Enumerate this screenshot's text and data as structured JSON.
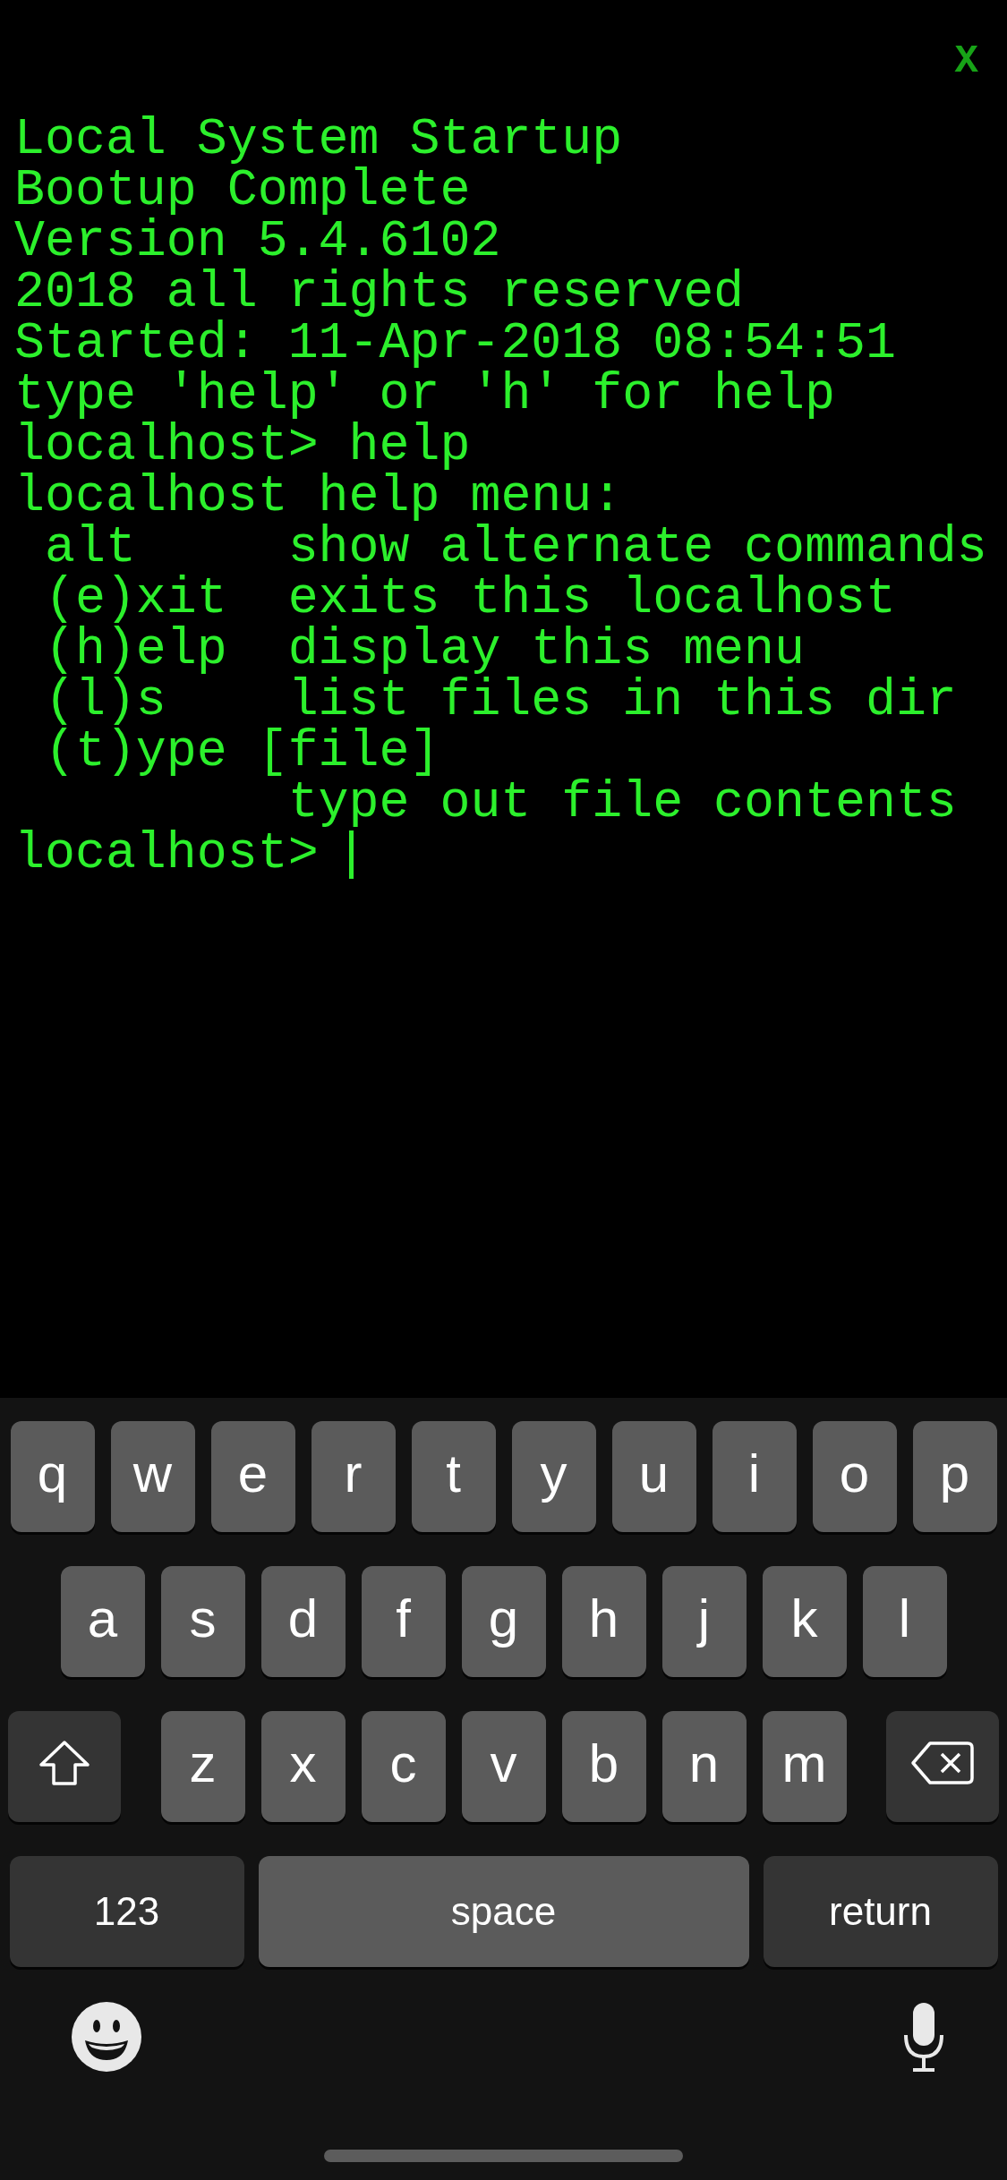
{
  "terminal": {
    "close_button": "X",
    "lines": [
      {
        "kind": "output",
        "text": "Local System Startup"
      },
      {
        "kind": "output",
        "text": "Bootup Complete"
      },
      {
        "kind": "output",
        "text": "Version 5.4.6102"
      },
      {
        "kind": "output",
        "text": "2018 all rights reserved"
      },
      {
        "kind": "output",
        "text": "Started: 11-Apr-2018 08:54:51"
      },
      {
        "kind": "output",
        "text": "type 'help' or 'h' for help"
      },
      {
        "kind": "prompt",
        "text": "localhost> help",
        "cursor": false
      },
      {
        "kind": "output",
        "text": "localhost help menu:"
      },
      {
        "kind": "menu_item",
        "command": "alt",
        "description": "show alternate commands"
      },
      {
        "kind": "menu_item",
        "command": "(e)xit",
        "description": "exits this localhost"
      },
      {
        "kind": "menu_item",
        "command": "(h)elp",
        "description": "display this menu"
      },
      {
        "kind": "menu_item",
        "command": "(l)s",
        "description": "list files in this dir"
      },
      {
        "kind": "menu_item",
        "command": "(t)ype [file]"
      },
      {
        "kind": "menu_item",
        "description": "type out file contents"
      },
      {
        "kind": "prompt",
        "text": "localhost>",
        "cursor": true
      }
    ]
  },
  "keyboard": {
    "letter_rows": [
      [
        {
          "kind": "letter",
          "label": "q"
        },
        {
          "kind": "letter",
          "label": "w"
        },
        {
          "kind": "letter",
          "label": "e"
        },
        {
          "kind": "letter",
          "label": "r"
        },
        {
          "kind": "letter",
          "label": "t"
        },
        {
          "kind": "letter",
          "label": "y"
        },
        {
          "kind": "letter",
          "label": "u"
        },
        {
          "kind": "letter",
          "label": "i"
        },
        {
          "kind": "letter",
          "label": "o"
        },
        {
          "kind": "letter",
          "label": "p"
        }
      ],
      [
        {
          "kind": "letter",
          "label": "a"
        },
        {
          "kind": "letter",
          "label": "s"
        },
        {
          "kind": "letter",
          "label": "d"
        },
        {
          "kind": "letter",
          "label": "f"
        },
        {
          "kind": "letter",
          "label": "g"
        },
        {
          "kind": "letter",
          "label": "h"
        },
        {
          "kind": "letter",
          "label": "j"
        },
        {
          "kind": "letter",
          "label": "k"
        },
        {
          "kind": "letter",
          "label": "l"
        }
      ],
      [
        {
          "kind": "shift"
        },
        {
          "kind": "letter",
          "label": "z"
        },
        {
          "kind": "letter",
          "label": "x"
        },
        {
          "kind": "letter",
          "label": "c"
        },
        {
          "kind": "letter",
          "label": "v"
        },
        {
          "kind": "letter",
          "label": "b"
        },
        {
          "kind": "letter",
          "label": "n"
        },
        {
          "kind": "letter",
          "label": "m"
        },
        {
          "kind": "delete"
        }
      ]
    ],
    "bottom_row": [
      {
        "kind": "mode",
        "label": "123"
      },
      {
        "kind": "space",
        "label": "space"
      },
      {
        "kind": "return",
        "label": "return"
      }
    ]
  }
}
